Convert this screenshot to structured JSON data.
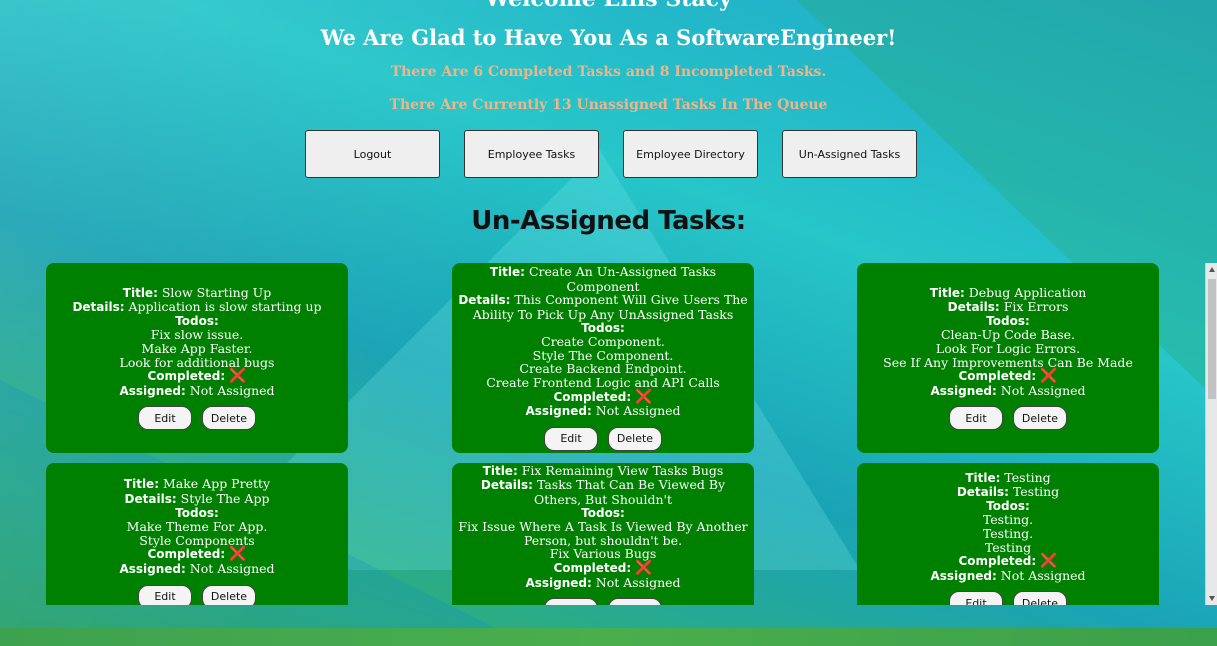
{
  "header": {
    "welcome": "Welcome Ellis Stacy",
    "subtitle": "We Are Glad to Have You As a SoftwareEngineer!",
    "stat_completed": "There Are 6 Completed Tasks and 8 Incompleted Tasks.",
    "stat_unassigned": "There Are Currently 13 Unassigned Tasks In The Queue"
  },
  "nav": {
    "logout": "Logout",
    "employee_tasks": "Employee Tasks",
    "employee_directory": "Employee Directory",
    "unassigned_tasks": "Un-Assigned Tasks"
  },
  "section_title": "Un-Assigned Tasks:",
  "labels": {
    "title": "Title:",
    "details": "Details:",
    "todos": "Todos:",
    "completed": "Completed:",
    "assigned": "Assigned:",
    "edit": "Edit",
    "delete": "Delete",
    "completed_icon": "❌"
  },
  "colors": {
    "card": "#008000",
    "stat_text": "#f0b48a"
  },
  "cards": [
    {
      "title": "Slow Starting Up",
      "details": "Application is slow starting up",
      "todos": [
        "Fix slow issue.",
        "Make App Faster.",
        "Look for additional bugs"
      ],
      "assigned": "Not Assigned"
    },
    {
      "title": "Create An Un-Assigned Tasks Component",
      "details": "This Component Will Give Users The Ability To Pick Up Any UnAssigned Tasks",
      "todos": [
        "Create Component.",
        "Style The Component.",
        "Create Backend Endpoint.",
        "Create Frontend Logic and API Calls"
      ],
      "assigned": "Not Assigned"
    },
    {
      "title": "Debug Application",
      "details": "Fix Errors",
      "todos": [
        "Clean-Up Code Base.",
        "Look For Logic Errors.",
        "See If Any Improvements Can Be Made"
      ],
      "assigned": "Not Assigned"
    },
    {
      "title": "Make App Pretty",
      "details": "Style The App",
      "todos": [
        "Make Theme For App.",
        "Style Components"
      ],
      "assigned": "Not Assigned"
    },
    {
      "title": "Fix Remaining View Tasks Bugs",
      "details": "Tasks That Can Be Viewed By Others, But Shouldn't",
      "todos": [
        "Fix Issue Where A Task Is Viewed By Another Person, but shouldn't be.",
        "Fix Various Bugs"
      ],
      "assigned": "Not Assigned"
    },
    {
      "title": "Testing",
      "details": "Testing",
      "todos": [
        "Testing.",
        "Testing.",
        "Testing"
      ],
      "assigned": "Not Assigned"
    }
  ]
}
